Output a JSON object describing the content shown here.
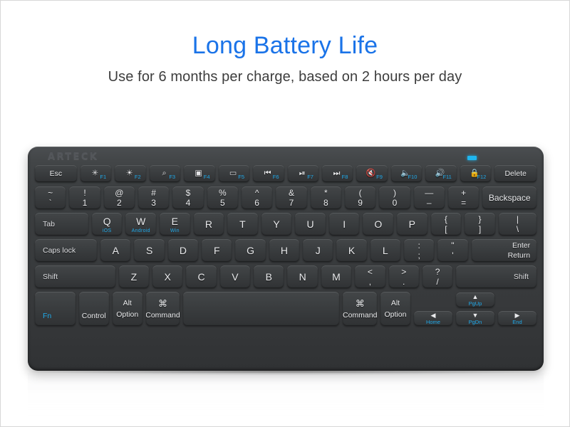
{
  "headline": "Long Battery Life",
  "subhead": "Use for 6 months per charge, based on 2 hours per day",
  "colors": {
    "headline_blue": "#1a73e8",
    "accent_cyan": "#1fa8e8",
    "led": "#1fb6ef",
    "keyboard_body": "#3b3e40",
    "key_face": "#3a3d3f",
    "subhead_gray": "#3d3d3d"
  },
  "keyboard": {
    "brand": "ARTECK",
    "led_indicator": "bluetooth-led",
    "function_row": [
      {
        "label": "Esc",
        "icon": "",
        "fn": "",
        "kind": "text",
        "w": 1.35
      },
      {
        "label": "",
        "icon": "✳",
        "fn": "F1",
        "kind": "icon",
        "icon_name": "brightness-down-icon",
        "w": 1
      },
      {
        "label": "",
        "icon": "☀",
        "fn": "F2",
        "kind": "icon",
        "icon_name": "brightness-up-icon",
        "w": 1
      },
      {
        "label": "",
        "icon": "⌕",
        "fn": "F3",
        "kind": "icon",
        "icon_name": "search-icon",
        "w": 1
      },
      {
        "label": "",
        "icon": "▣",
        "fn": "F4",
        "kind": "icon",
        "icon_name": "screenshot-icon",
        "w": 1
      },
      {
        "label": "",
        "icon": "▭",
        "fn": "F5",
        "kind": "icon",
        "icon_name": "keyboard-backlight-icon",
        "w": 1
      },
      {
        "label": "",
        "icon": "⏮",
        "fn": "F6",
        "kind": "icon",
        "icon_name": "previous-track-icon",
        "w": 1
      },
      {
        "label": "",
        "icon": "⏯",
        "fn": "F7",
        "kind": "icon",
        "icon_name": "play-pause-icon",
        "w": 1
      },
      {
        "label": "",
        "icon": "⏭",
        "fn": "F8",
        "kind": "icon",
        "icon_name": "next-track-icon",
        "w": 1
      },
      {
        "label": "",
        "icon": "🔇",
        "fn": "F9",
        "kind": "icon",
        "icon_name": "mute-icon",
        "w": 1
      },
      {
        "label": "",
        "icon": "🔈",
        "fn": "F10",
        "kind": "icon",
        "icon_name": "volume-down-icon",
        "w": 1
      },
      {
        "label": "",
        "icon": "🔊",
        "fn": "F11",
        "kind": "icon",
        "icon_name": "volume-up-icon",
        "w": 1
      },
      {
        "label": "",
        "icon": "🔒",
        "fn": "F12",
        "kind": "icon",
        "icon_name": "lock-icon",
        "w": 1
      },
      {
        "label": "Delete",
        "icon": "",
        "fn": "",
        "kind": "text",
        "w": 1.35
      }
    ],
    "number_row": [
      {
        "top": "~",
        "bot": "`",
        "name": "key-tilde",
        "w": 1
      },
      {
        "top": "!",
        "bot": "1",
        "name": "key-1",
        "w": 1
      },
      {
        "top": "@",
        "bot": "2",
        "name": "key-2",
        "w": 1
      },
      {
        "top": "#",
        "bot": "3",
        "name": "key-3",
        "w": 1
      },
      {
        "top": "$",
        "bot": "4",
        "name": "key-4",
        "w": 1
      },
      {
        "top": "%",
        "bot": "5",
        "name": "key-5",
        "w": 1
      },
      {
        "top": "^",
        "bot": "6",
        "name": "key-6",
        "w": 1
      },
      {
        "top": "&",
        "bot": "7",
        "name": "key-7",
        "w": 1
      },
      {
        "top": "*",
        "bot": "8",
        "name": "key-8",
        "w": 1
      },
      {
        "top": "(",
        "bot": "9",
        "name": "key-9",
        "w": 1
      },
      {
        "top": ")",
        "bot": "0",
        "name": "key-0",
        "w": 1
      },
      {
        "top": "—",
        "bot": "–",
        "name": "key-minus",
        "w": 1
      },
      {
        "top": "+",
        "bot": "=",
        "name": "key-equal",
        "w": 1
      },
      {
        "label": "Backspace",
        "name": "key-backspace",
        "w": 1.75,
        "align": "center"
      }
    ],
    "qwerty_row": [
      {
        "label": "Tab",
        "name": "key-tab",
        "w": 1.5,
        "align": "left"
      },
      {
        "label": "Q",
        "os": "iOS",
        "name": "key-q",
        "w": 1
      },
      {
        "label": "W",
        "os": "Android",
        "name": "key-w",
        "w": 1
      },
      {
        "label": "E",
        "os": "Win",
        "name": "key-e",
        "w": 1
      },
      {
        "label": "R",
        "name": "key-r",
        "w": 1
      },
      {
        "label": "T",
        "name": "key-t",
        "w": 1
      },
      {
        "label": "Y",
        "name": "key-y",
        "w": 1
      },
      {
        "label": "U",
        "name": "key-u",
        "w": 1
      },
      {
        "label": "I",
        "name": "key-i",
        "w": 1
      },
      {
        "label": "O",
        "name": "key-o",
        "w": 1
      },
      {
        "label": "P",
        "name": "key-p",
        "w": 1
      },
      {
        "top": "{",
        "bot": "[",
        "name": "key-bracket-left",
        "w": 1
      },
      {
        "top": "}",
        "bot": "]",
        "name": "key-bracket-right",
        "w": 1
      },
      {
        "top": "|",
        "bot": "\\",
        "name": "key-backslash",
        "w": 1.25
      }
    ],
    "home_row": [
      {
        "label": "Caps lock",
        "name": "key-caps-lock",
        "w": 1.8,
        "align": "left"
      },
      {
        "label": "A",
        "name": "key-a",
        "w": 1
      },
      {
        "label": "S",
        "name": "key-s",
        "w": 1
      },
      {
        "label": "D",
        "name": "key-d",
        "w": 1
      },
      {
        "label": "F",
        "name": "key-f",
        "w": 1
      },
      {
        "label": "G",
        "name": "key-g",
        "w": 1
      },
      {
        "label": "H",
        "name": "key-h",
        "w": 1
      },
      {
        "label": "J",
        "name": "key-j",
        "w": 1
      },
      {
        "label": "K",
        "name": "key-k",
        "w": 1
      },
      {
        "label": "L",
        "name": "key-l",
        "w": 1
      },
      {
        "top": ":",
        "bot": ";",
        "name": "key-semicolon",
        "w": 1
      },
      {
        "top": "\"",
        "bot": "'",
        "name": "key-quote",
        "w": 1
      },
      {
        "enter_top": "Enter",
        "enter_bot": "Return",
        "name": "key-enter",
        "w": 1.95
      }
    ],
    "shift_row": [
      {
        "label": "Shift",
        "name": "key-shift-left",
        "w": 2.4,
        "align": "left"
      },
      {
        "label": "Z",
        "name": "key-z",
        "w": 1
      },
      {
        "label": "X",
        "name": "key-x",
        "w": 1
      },
      {
        "label": "C",
        "name": "key-c",
        "w": 1
      },
      {
        "label": "V",
        "name": "key-v",
        "w": 1
      },
      {
        "label": "B",
        "name": "key-b",
        "w": 1
      },
      {
        "label": "N",
        "name": "key-n",
        "w": 1
      },
      {
        "label": "M",
        "name": "key-m",
        "w": 1
      },
      {
        "top": "<",
        "bot": ",",
        "name": "key-comma",
        "w": 1
      },
      {
        "top": ">",
        "bot": ".",
        "name": "key-period",
        "w": 1
      },
      {
        "top": "?",
        "bot": "/",
        "name": "key-slash",
        "w": 1
      },
      {
        "label": "Shift",
        "name": "key-shift-right",
        "w": 2.4,
        "align": "right"
      }
    ],
    "bottom_row": [
      {
        "label": "Fn",
        "name": "key-fn",
        "kind": "fn",
        "w": 1.25
      },
      {
        "label": "Control",
        "name": "key-control",
        "kind": "ctrl",
        "w": 1.15
      },
      {
        "top": "Alt",
        "bot": "Option",
        "name": "key-alt-option-left",
        "kind": "mod2",
        "w": 1.15
      },
      {
        "top": "⌘",
        "bot": "Command",
        "name": "key-command-left",
        "kind": "mod2cmd",
        "w": 1.3
      },
      {
        "label": "",
        "name": "key-space",
        "kind": "space",
        "w": 6.0
      },
      {
        "top": "⌘",
        "bot": "Command",
        "name": "key-command-right",
        "kind": "mod2cmd",
        "w": 1.3
      },
      {
        "top": "Alt",
        "bot": "Option",
        "name": "key-alt-option-right",
        "kind": "mod2",
        "w": 1.15
      }
    ],
    "arrow_cluster": [
      {
        "arrow": "◀",
        "sub": "Home",
        "name": "key-arrow-left"
      },
      {
        "arrow": "▲",
        "sub": "PgUp",
        "name": "key-arrow-up"
      },
      {
        "arrow": "▼",
        "sub": "PgDn",
        "name": "key-arrow-down"
      },
      {
        "arrow": "▶",
        "sub": "End",
        "name": "key-arrow-right"
      }
    ]
  }
}
